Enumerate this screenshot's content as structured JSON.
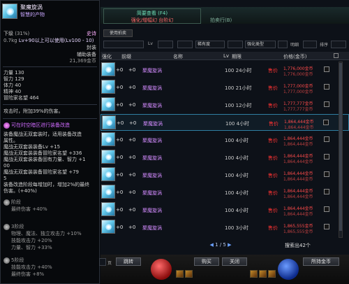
{
  "tooltip": {
    "name": "聚魔旋涡",
    "subtitle": "智慧的产物",
    "grade": "下级",
    "grade_pct": "(31%)",
    "rarity": "史诗",
    "weight": "0.7kg",
    "level_req": "Lv+90以上可以使用(Lv100 - 10)",
    "sealed": "封装",
    "type": "辅助装备",
    "extra": "21,369金币",
    "stats": [
      {
        "label": "力量",
        "value": "130"
      },
      {
        "label": "智力",
        "value": "129"
      },
      {
        "label": "体力",
        "value": "40"
      },
      {
        "label": "精神",
        "value": "40"
      },
      {
        "label": "冒险家名望",
        "value": "464"
      }
    ],
    "attack_note": "攻击时，附加39%的伤害。",
    "tune_note": "可在时空暗区进行装备改造",
    "set_lines": [
      "装备魔战无双套装时，适用装备改造",
      "属性。",
      "魔战无双套装装备Lv +15",
      "魔战无双套装装备冒险家名望 +336",
      "魔战无双套装装备固有力量、智力 +1",
      "00",
      "魔战无双套装装备冒险家名望 +79",
      "5",
      "装备改造阶段每增加时，增加2%的最终",
      "伤害。(+40%)"
    ],
    "stage1_title": "阶段",
    "stage1_line": "最终伤害 +40%",
    "stage2_title": "3阶段",
    "stage2_lines": [
      "物理、魔法、独立攻击力 +10%",
      "技能攻击力 +20%",
      "力量、智力 +33%"
    ],
    "stage3_title": "5阶段",
    "stage3_lines": [
      "技能攻击力 +40%",
      "最终伤害 +8%"
    ]
  },
  "panel": {
    "tab_title": "简要查看 (F4)",
    "tab_sub": "强化/增幅幻 台阶幻",
    "tab2": "拍卖行(B)",
    "buy_register": "使用拍卖",
    "filter_lv_label": "Lv",
    "filter_rarity": "稀有度",
    "filter_reinforce": "强化类型",
    "filter_limited": "明细",
    "filter_sort": "排序",
    "header": {
      "col1": "强化",
      "col2": "前缀",
      "col3": "名称",
      "col4": "Lv",
      "col5": "期限",
      "col6": "价格(金币)"
    },
    "rows": [
      {
        "level": "+0",
        "plus": "+0",
        "name": "聚魔旋涡",
        "lv": "100",
        "time": "24小时",
        "tag": "售价",
        "price": "1,776,000金币",
        "total": "1,776,000金币"
      },
      {
        "level": "+0",
        "plus": "+0",
        "name": "聚魔旋涡",
        "lv": "100",
        "time": "21小时",
        "tag": "售价",
        "price": "1,777,000金币",
        "total": "1,777,000金币"
      },
      {
        "level": "+0",
        "plus": "+0",
        "name": "聚魔旋涡",
        "lv": "100",
        "time": "12小时",
        "tag": "售价",
        "price": "1,777,777金币",
        "total": "1,777,777金币"
      },
      {
        "level": "+0",
        "plus": "+0",
        "name": "聚魔旋涡",
        "lv": "100",
        "time": "4小时",
        "tag": "售价",
        "price": "1,864,444金币",
        "total": "1,864,444金币"
      },
      {
        "level": "+0",
        "plus": "+0",
        "name": "聚魔旋涡",
        "lv": "100",
        "time": "4小时",
        "tag": "售价",
        "price": "1,864,444金币",
        "total": "1,864,444金币"
      },
      {
        "level": "+0",
        "plus": "+0",
        "name": "聚魔旋涡",
        "lv": "100",
        "time": "4小时",
        "tag": "售价",
        "price": "1,864,444金币",
        "total": "1,864,444金币"
      },
      {
        "level": "+0",
        "plus": "+0",
        "name": "聚魔旋涡",
        "lv": "100",
        "time": "4小时",
        "tag": "售价",
        "price": "1,864,444金币",
        "total": "1,864,444金币"
      },
      {
        "level": "+0",
        "plus": "+0",
        "name": "聚魔旋涡",
        "lv": "100",
        "time": "4小时",
        "tag": "售价",
        "price": "1,864,444金币",
        "total": "1,864,444金币"
      },
      {
        "level": "+0",
        "plus": "+0",
        "name": "聚魔旋涡",
        "lv": "100",
        "time": "4小时",
        "tag": "售价",
        "price": "1,864,444金币",
        "total": "1,864,444金币"
      },
      {
        "level": "+0",
        "plus": "+0",
        "name": "聚魔旋涡",
        "lv": "100",
        "time": "3小时",
        "tag": "售价",
        "price": "1,865,555金币",
        "total": "1,865,555金币"
      }
    ],
    "pager": "1 / 5",
    "found": "搜索出42个",
    "btn_page": "页",
    "btn_jump": "跳转",
    "btn_buy": "购买",
    "btn_close": "关闭",
    "btn_gold": "所持金币"
  },
  "colors": {
    "accent": "#2f7ea2",
    "price": "#ff4b4b",
    "name": "#d48cff"
  }
}
